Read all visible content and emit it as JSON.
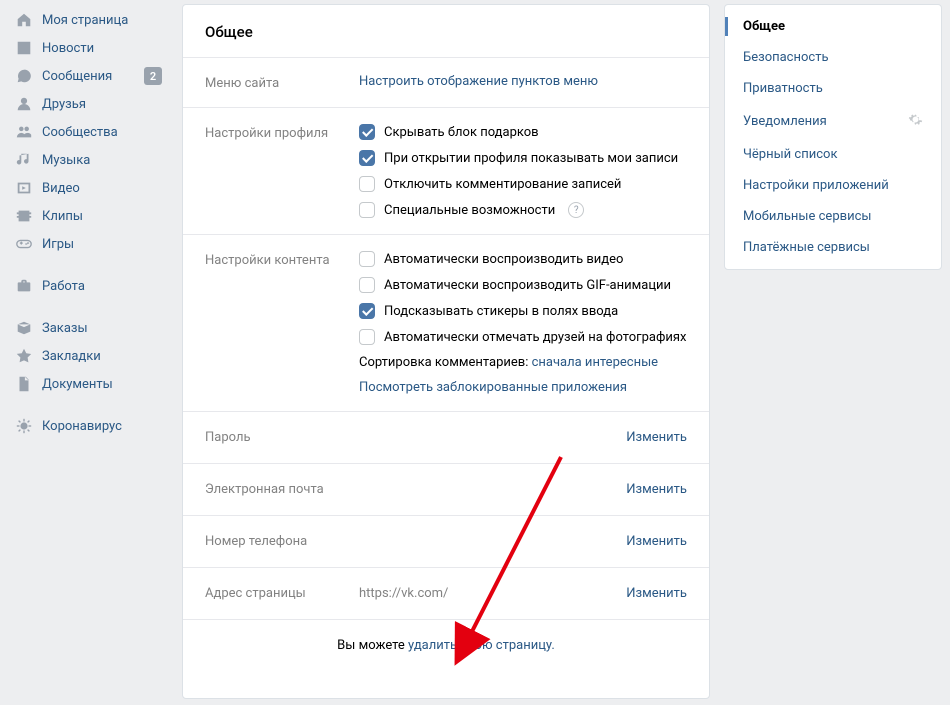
{
  "nav": {
    "items": [
      {
        "label": "Моя страница",
        "icon": "home"
      },
      {
        "label": "Новости",
        "icon": "newspaper"
      },
      {
        "label": "Сообщения",
        "icon": "chat",
        "badge": "2"
      },
      {
        "label": "Друзья",
        "icon": "user"
      },
      {
        "label": "Сообщества",
        "icon": "group"
      },
      {
        "label": "Музыка",
        "icon": "music"
      },
      {
        "label": "Видео",
        "icon": "video"
      },
      {
        "label": "Клипы",
        "icon": "clips"
      },
      {
        "label": "Игры",
        "icon": "gamepad"
      }
    ],
    "work": {
      "label": "Работа",
      "icon": "briefcase"
    },
    "extras": [
      {
        "label": "Заказы",
        "icon": "box"
      },
      {
        "label": "Закладки",
        "icon": "star"
      },
      {
        "label": "Документы",
        "icon": "doc"
      }
    ],
    "corona": {
      "label": "Коронавирус",
      "icon": "virus"
    }
  },
  "main": {
    "title": "Общее",
    "menuSection": {
      "label": "Меню сайта",
      "action": "Настроить отображение пунктов меню"
    },
    "profileSection": {
      "label": "Настройки профиля",
      "opts": [
        {
          "label": "Скрывать блок подарков",
          "checked": true
        },
        {
          "label": "При открытии профиля показывать мои записи",
          "checked": true
        },
        {
          "label": "Отключить комментирование записей",
          "checked": false
        },
        {
          "label": "Специальные возможности",
          "checked": false,
          "help": true
        }
      ]
    },
    "contentSection": {
      "label": "Настройки контента",
      "opts": [
        {
          "label": "Автоматически воспроизводить видео",
          "checked": false
        },
        {
          "label": "Автоматически воспроизводить GIF-анимации",
          "checked": false
        },
        {
          "label": "Подсказывать стикеры в полях ввода",
          "checked": true
        },
        {
          "label": "Автоматически отмечать друзей на фотографиях",
          "checked": false
        }
      ],
      "sortPrefix": "Сортировка комментариев: ",
      "sortLink": "сначала интересные",
      "blockedLink": "Посмотреть заблокированные приложения"
    },
    "rows": {
      "password": {
        "label": "Пароль",
        "action": "Изменить"
      },
      "email": {
        "label": "Электронная почта",
        "action": "Изменить"
      },
      "phone": {
        "label": "Номер телефона",
        "action": "Изменить"
      },
      "address": {
        "label": "Адрес страницы",
        "value": "https://vk.com/",
        "action": "Изменить"
      }
    },
    "footer": {
      "prefix": "Вы можете ",
      "link": "удалить свою страницу."
    }
  },
  "side": {
    "items": [
      {
        "label": "Общее",
        "active": true
      },
      {
        "label": "Безопасность"
      },
      {
        "label": "Приватность"
      },
      {
        "label": "Уведомления",
        "gear": true
      },
      {
        "label": "Чёрный список"
      },
      {
        "label": "Настройки приложений"
      },
      {
        "label": "Мобильные сервисы"
      },
      {
        "label": "Платёжные сервисы"
      }
    ]
  }
}
